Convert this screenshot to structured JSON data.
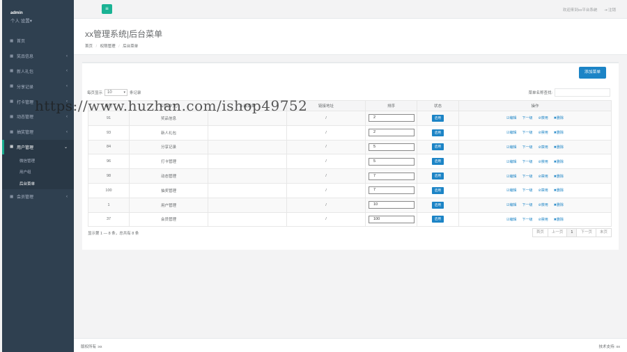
{
  "sidebar": {
    "username": "admin",
    "profile_menu": "个人 设置▾",
    "items": [
      {
        "label": "首页",
        "arrow": ""
      },
      {
        "label": "奖品信息",
        "arrow": "‹"
      },
      {
        "label": "新人礼包",
        "arrow": "‹"
      },
      {
        "label": "分享记录",
        "arrow": "‹"
      },
      {
        "label": "打卡管理",
        "arrow": "‹"
      },
      {
        "label": "动态管理",
        "arrow": "‹"
      },
      {
        "label": "抽奖管理",
        "arrow": "‹"
      }
    ],
    "active": {
      "label": "用户管理",
      "arrow": "⌄"
    },
    "subitems": [
      "微信管理",
      "用户组",
      "后台菜单"
    ],
    "after": {
      "label": "会员管理",
      "arrow": "‹"
    }
  },
  "topbar": {
    "menu_icon": "≡",
    "welcome": "欢迎来到xx平台系统",
    "logout": "⇥ 注销"
  },
  "heading": {
    "title": "xx管理系统|后台菜单",
    "crumbs": [
      "首页",
      "权限管理",
      "后台菜单"
    ],
    "sep": "/"
  },
  "toolbar": {
    "add_label": "添加菜单",
    "len_prefix": "每页显示",
    "len_value": "10",
    "len_suffix": "条记录",
    "search_label": "菜单名称查找:"
  },
  "table": {
    "headers": [
      "编号",
      "名称(中文)",
      "上级菜单",
      "链接地址",
      "排序",
      "状态",
      "操作"
    ],
    "rows": [
      {
        "id": "91",
        "name": "奖品信息",
        "parent": "",
        "link": "/",
        "sort": "2",
        "status": "启用"
      },
      {
        "id": "93",
        "name": "新人礼包",
        "parent": "",
        "link": "/",
        "sort": "2",
        "status": "启用"
      },
      {
        "id": "84",
        "name": "分享记录",
        "parent": "",
        "link": "/",
        "sort": "5",
        "status": "启用"
      },
      {
        "id": "96",
        "name": "打卡管理",
        "parent": "",
        "link": "/",
        "sort": "5",
        "status": "启用"
      },
      {
        "id": "98",
        "name": "动态管理",
        "parent": "",
        "link": "/",
        "sort": "7",
        "status": "启用"
      },
      {
        "id": "100",
        "name": "抽奖管理",
        "parent": "",
        "link": "/",
        "sort": "7",
        "status": "启用"
      },
      {
        "id": "1",
        "name": "用户管理",
        "parent": "",
        "link": "/",
        "sort": "10",
        "status": "启用"
      },
      {
        "id": "37",
        "name": "会员管理",
        "parent": "",
        "link": "/",
        "sort": "100",
        "status": "启用"
      }
    ],
    "ops": [
      "☑编辑",
      "下一级",
      "⊘禁用",
      "✖删除"
    ]
  },
  "pagination": {
    "info": "显示第 1 — 8 条，总共有 8 条",
    "buttons": [
      "首页",
      "上一页",
      "1",
      "下一页",
      "末页"
    ]
  },
  "footer": {
    "copyright": "版权所有 :xx",
    "support": "技术支持: xx"
  },
  "watermark": "https://www.huzhan.com/ishop49752",
  "colors": {
    "sidebar": "#2f4050",
    "accent": "#1ab394",
    "primary": "#1c84c6"
  }
}
